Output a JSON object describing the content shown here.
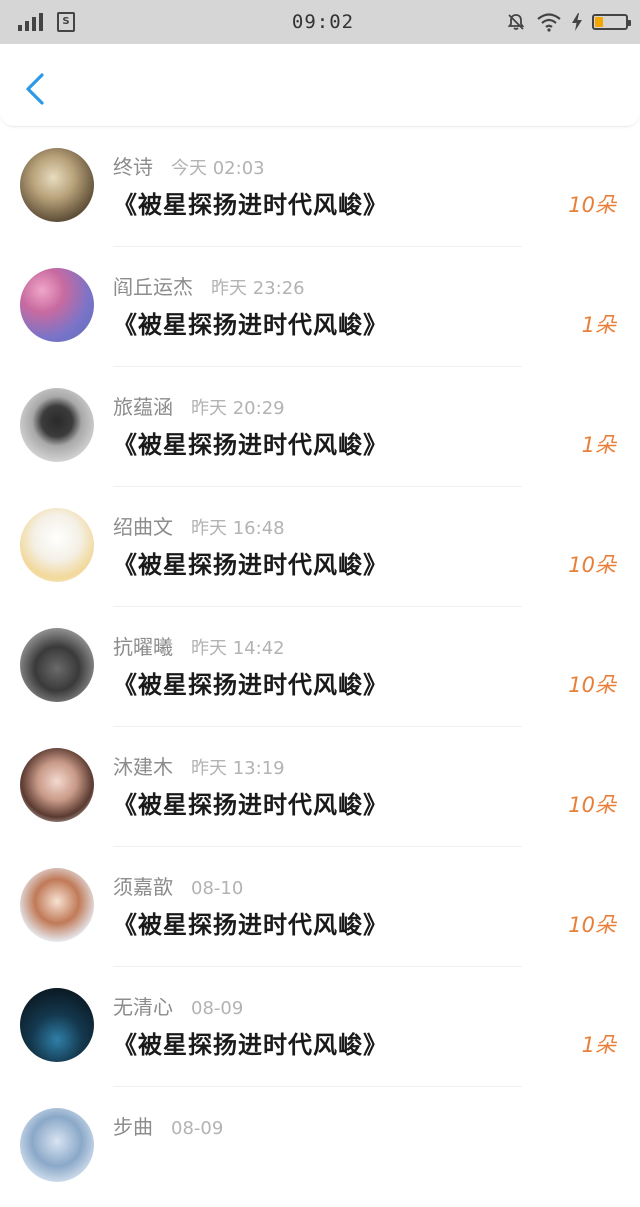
{
  "status_bar": {
    "time": "09:02",
    "battery_level": 0.25,
    "battery_color": "#f4a700",
    "icons": [
      "signal-icon",
      "sim-icon",
      "mute-icon",
      "wifi-icon",
      "charging-icon",
      "battery-icon"
    ]
  },
  "header": {
    "back_icon": "chevron-left-icon",
    "accent_color": "#2a9ae6"
  },
  "items": [
    {
      "name": "终诗",
      "time": "今天 02:03",
      "title": "《被星探扬进时代风峻》",
      "count": "10朵"
    },
    {
      "name": "阎丘运杰",
      "time": "昨天 23:26",
      "title": "《被星探扬进时代风峻》",
      "count": "1朵"
    },
    {
      "name": "旅蕴涵",
      "time": "昨天 20:29",
      "title": "《被星探扬进时代风峻》",
      "count": "1朵"
    },
    {
      "name": "绍曲文",
      "time": "昨天 16:48",
      "title": "《被星探扬进时代风峻》",
      "count": "10朵"
    },
    {
      "name": "抗曜曦",
      "time": "昨天 14:42",
      "title": "《被星探扬进时代风峻》",
      "count": "10朵"
    },
    {
      "name": "沐建木",
      "time": "昨天 13:19",
      "title": "《被星探扬进时代风峻》",
      "count": "10朵"
    },
    {
      "name": "须嘉歆",
      "time": "08-10",
      "title": "《被星探扬进时代风峻》",
      "count": "10朵"
    },
    {
      "name": "无清心",
      "time": "08-09",
      "title": "《被星探扬进时代风峻》",
      "count": "1朵"
    },
    {
      "name": "步曲",
      "time": "08-09",
      "title": "",
      "count": ""
    }
  ],
  "colors": {
    "count": "#e8803a",
    "name": "#8c8c8c",
    "time": "#b3b3b3",
    "title": "#1a1a1a"
  }
}
